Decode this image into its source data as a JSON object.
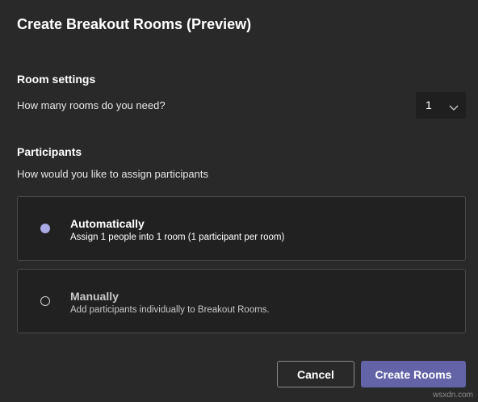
{
  "dialog": {
    "title": "Create Breakout Rooms (Preview)"
  },
  "room_settings": {
    "heading": "Room settings",
    "question": "How many rooms do you need?",
    "rooms_count": "1",
    "chevron_icon": "chevron-down-icon"
  },
  "participants": {
    "heading": "Participants",
    "question": "How would you like to assign participants",
    "options": [
      {
        "title": "Automatically",
        "description": "Assign 1 people into 1 room (1 participant per room)",
        "selected": true
      },
      {
        "title": "Manually",
        "description": "Add participants individually to Breakout Rooms.",
        "selected": false
      }
    ]
  },
  "buttons": {
    "cancel_label": "Cancel",
    "create_label": "Create Rooms"
  },
  "colors": {
    "background": "#292929",
    "accent": "#6264a7",
    "radio_selected": "#aaa9e6"
  },
  "watermark": "wsxdn.com"
}
